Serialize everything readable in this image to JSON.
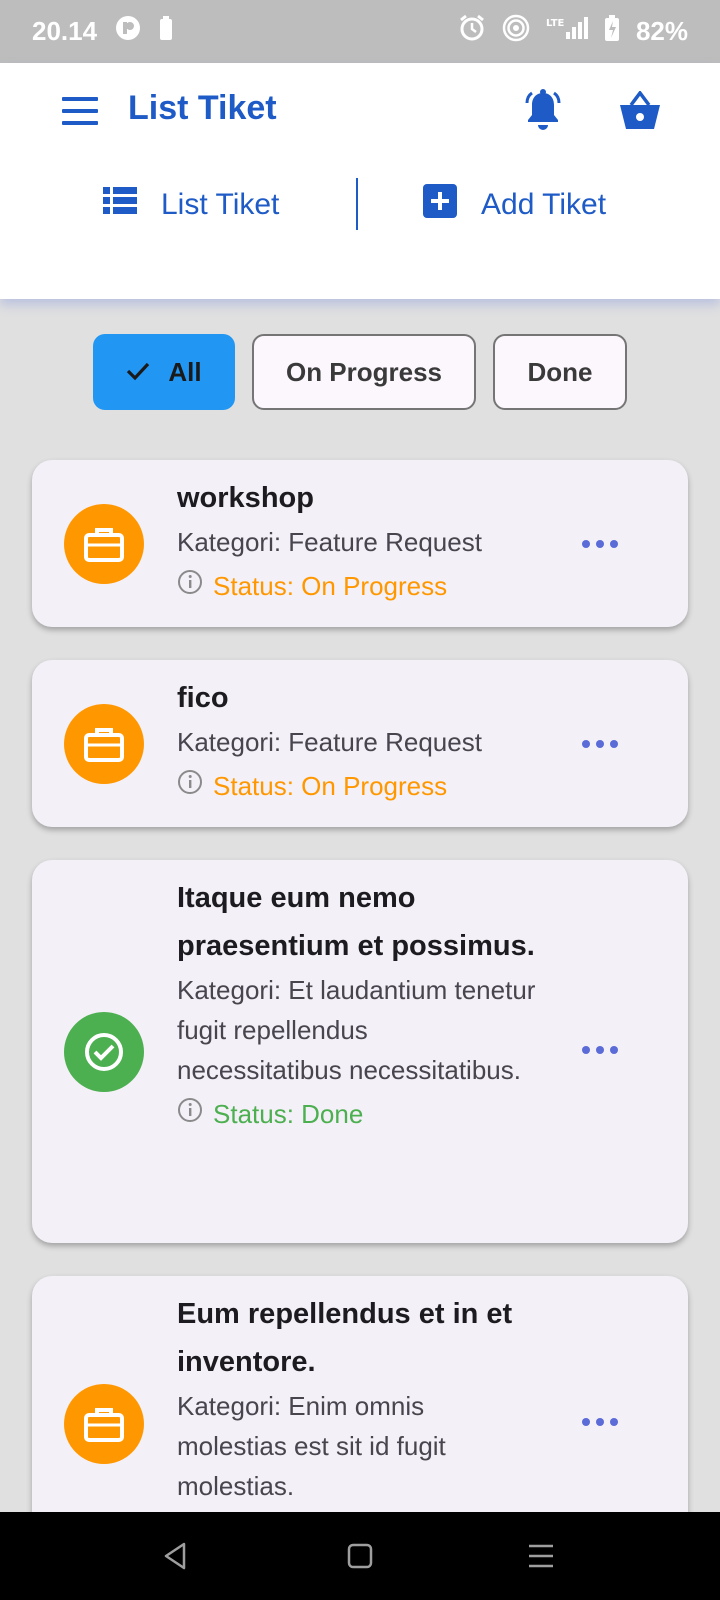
{
  "status_bar": {
    "time": "20.14",
    "battery": "82%",
    "icons": [
      "notification-app-icon",
      "battery-saver-icon",
      "alarm-icon",
      "hotspot-icon",
      "lte-signal-icon",
      "battery-charging-icon"
    ]
  },
  "header": {
    "title": "List Tiket",
    "menu_icon": "hamburger-menu-icon",
    "bell_icon": "bell-icon",
    "basket_icon": "basket-icon"
  },
  "nav_tabs": {
    "list_label": "List Tiket",
    "list_icon": "list-icon",
    "add_label": "Add Tiket",
    "add_icon": "add-box-icon"
  },
  "filters": {
    "all_label": "All",
    "progress_label": "On Progress",
    "done_label": "Done",
    "selected": "All"
  },
  "tickets": [
    {
      "title": "workshop",
      "category": "Kategori: Feature Request",
      "status": "Status: On Progress",
      "icon": "briefcase-icon"
    },
    {
      "title": "fico",
      "category": "Kategori: Feature Request",
      "status": "Status: On Progress",
      "icon": "briefcase-icon"
    },
    {
      "title": "Itaque eum nemo praesentium et possimus.",
      "category": "Kategori: Et laudantium tenetur fugit repellendus necessitatibus necessitatibus.",
      "status": "Status: Done",
      "icon": "check-circle-icon"
    },
    {
      "title": "Eum repellendus et in et inventore.",
      "category": "Kategori: Enim omnis molestias est sit id fugit molestias.",
      "status": "",
      "icon": "briefcase-icon"
    }
  ],
  "colors": {
    "primary": "#1e5bc6",
    "chip_selected": "#2196f3",
    "progress": "#ff9800",
    "done": "#4caf50",
    "more_dots": "#5b6bd8"
  }
}
